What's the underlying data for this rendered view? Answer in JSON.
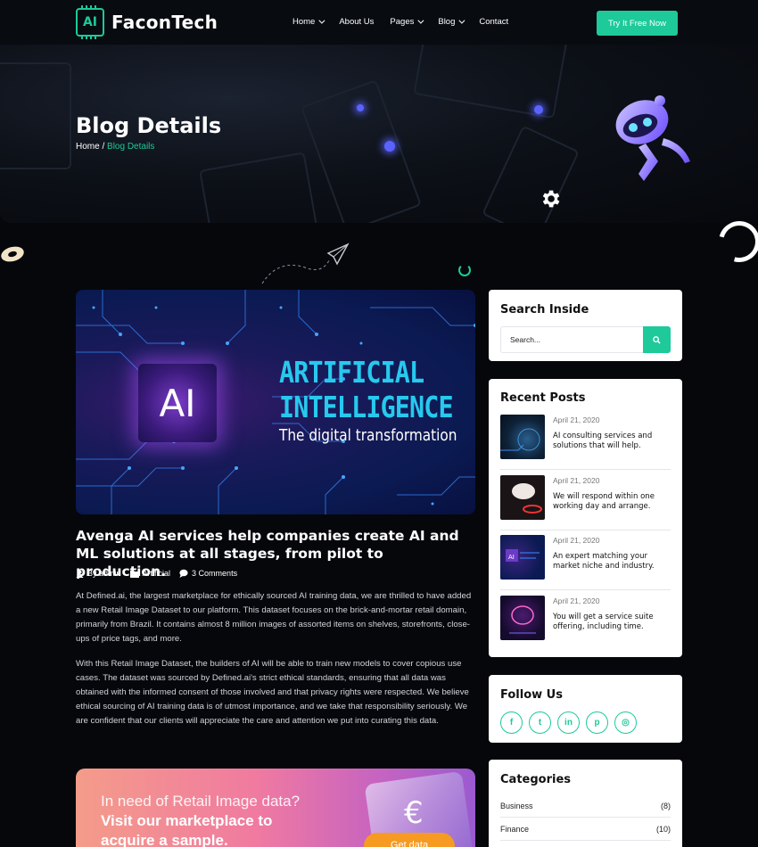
{
  "brand": {
    "logo_chip": "AI",
    "name": "FaconTech",
    "accent": "#1ec99a"
  },
  "nav": {
    "items": [
      {
        "label": "Home",
        "dropdown": true
      },
      {
        "label": "About Us",
        "dropdown": false
      },
      {
        "label": "Pages",
        "dropdown": true
      },
      {
        "label": "Blog",
        "dropdown": true
      },
      {
        "label": "Contact",
        "dropdown": false
      }
    ],
    "cta_label": "Try It Free Now"
  },
  "hero": {
    "title": "Blog Details",
    "breadcrumb": {
      "home": "Home",
      "separator": " / ",
      "current": "Blog Details"
    }
  },
  "feature_image": {
    "chip_text": "AI",
    "line1": "ARTIFICIAL",
    "line2": "INTELLIGENCE",
    "line3": "The digital transformation"
  },
  "post": {
    "title": "Avenga AI services help companies create AI and ML solutions at all stages, from pilot to production.",
    "meta": {
      "author": "By admin",
      "category": "Artificial",
      "comments": "3 Comments"
    },
    "paragraphs": [
      "At Defined.ai, the largest marketplace for ethically sourced AI training data, we are thrilled to have added a new Retail Image Dataset to our platform. This dataset focuses on the brick-and-mortar retail domain, primarily from Brazil. It contains almost 8 million images of assorted items on shelves, storefronts, close-ups of price tags, and more.",
      "With this Retail Image Dataset, the builders of AI will be able to train new models to cover copious use cases. The dataset was sourced by Defined.ai's strict ethical standards, ensuring that all data was obtained with the informed consent of those involved and that privacy rights were respected. We believe ethical sourcing of AI training data is of utmost importance, and we take that responsibility seriously. We are confident that our clients will appreciate the care and attention we put into curating this data."
    ]
  },
  "promo": {
    "line1": "In need of Retail Image data?",
    "line2": "Visit our marketplace to",
    "line3": "acquire a sample.",
    "button": "Get data",
    "symbol": "€"
  },
  "sidebar": {
    "search": {
      "title": "Search Inside",
      "placeholder": "Search..."
    },
    "recent": {
      "title": "Recent Posts",
      "posts": [
        {
          "date": "April 21, 2020",
          "title": "AI consulting services and solutions that will help."
        },
        {
          "date": "April 21, 2020",
          "title": "We will respond within one working day and arrange."
        },
        {
          "date": "April 21, 2020",
          "title": "An expert matching your market niche and industry."
        },
        {
          "date": "April 21, 2020",
          "title": "You will get a service suite offering, including time."
        }
      ]
    },
    "follow": {
      "title": "Follow Us",
      "icons": [
        "facebook-icon",
        "twitter-icon",
        "linkedin-icon",
        "pinterest-icon",
        "instagram-icon"
      ],
      "glyphs": [
        "f",
        "t",
        "in",
        "p",
        "◎"
      ]
    },
    "categories": {
      "title": "Categories",
      "items": [
        {
          "name": "Business",
          "count": "(8)"
        },
        {
          "name": "Finance",
          "count": "(10)"
        }
      ]
    }
  }
}
